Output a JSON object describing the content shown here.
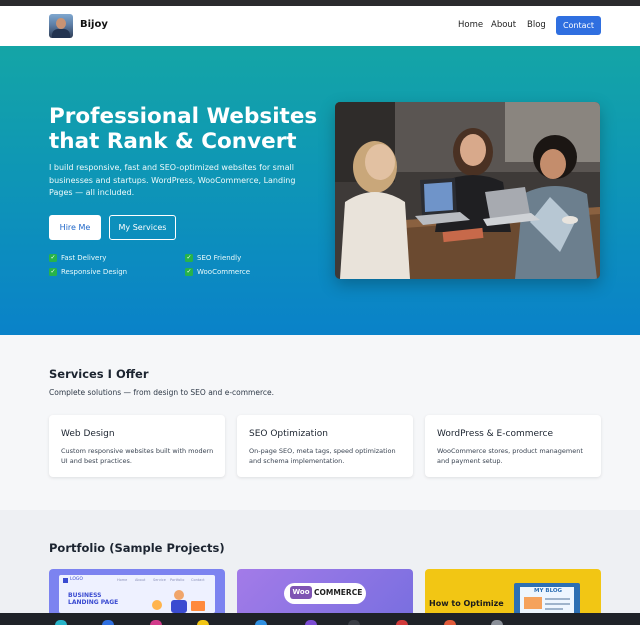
{
  "nav": {
    "brand": "Bijoy",
    "links": [
      "Home",
      "About",
      "Blog"
    ],
    "contact_label": "Contact"
  },
  "hero": {
    "title": "Professional Websites that Rank & Convert",
    "subtitle": "I build responsive, fast and SEO-optimized websites for small businesses and startups. WordPress, WooCommerce, Landing Pages — all included.",
    "hire_label": "Hire Me",
    "services_label": "My Services",
    "features": [
      "Fast Delivery",
      "SEO Friendly",
      "Responsive Design",
      "WooCommerce"
    ]
  },
  "services": {
    "title": "Services I Offer",
    "subtitle": "Complete solutions — from design to SEO and e-commerce.",
    "cards": [
      {
        "title": "Web Design",
        "desc": "Custom responsive websites built with modern UI and best practices."
      },
      {
        "title": "SEO Optimization",
        "desc": "On-page SEO, meta tags, speed optimization and schema implementation."
      },
      {
        "title": "WordPress & E-commerce",
        "desc": "WooCommerce stores, product management and payment setup."
      }
    ]
  },
  "portfolio": {
    "title": "Portfolio (Sample Projects)",
    "thumbs": [
      {
        "title": "BUSINESS LANDING PAGE",
        "logo": "LOGO",
        "menu": [
          "Home",
          "About",
          "Service",
          "Portfolio",
          "Contact"
        ]
      },
      {
        "title": "WOO COMMERCE",
        "mark": "Woo",
        "word": "COMMERCE"
      },
      {
        "title": "How to Optimize",
        "blog": "MY BLOG"
      }
    ]
  },
  "icons": [
    "check-icon",
    "avatar-photo"
  ],
  "colors": {
    "accent": "#2f6fe0",
    "hero_top": "#14a5a6",
    "hero_bottom": "#0a82c9",
    "check": "#27b34a"
  }
}
